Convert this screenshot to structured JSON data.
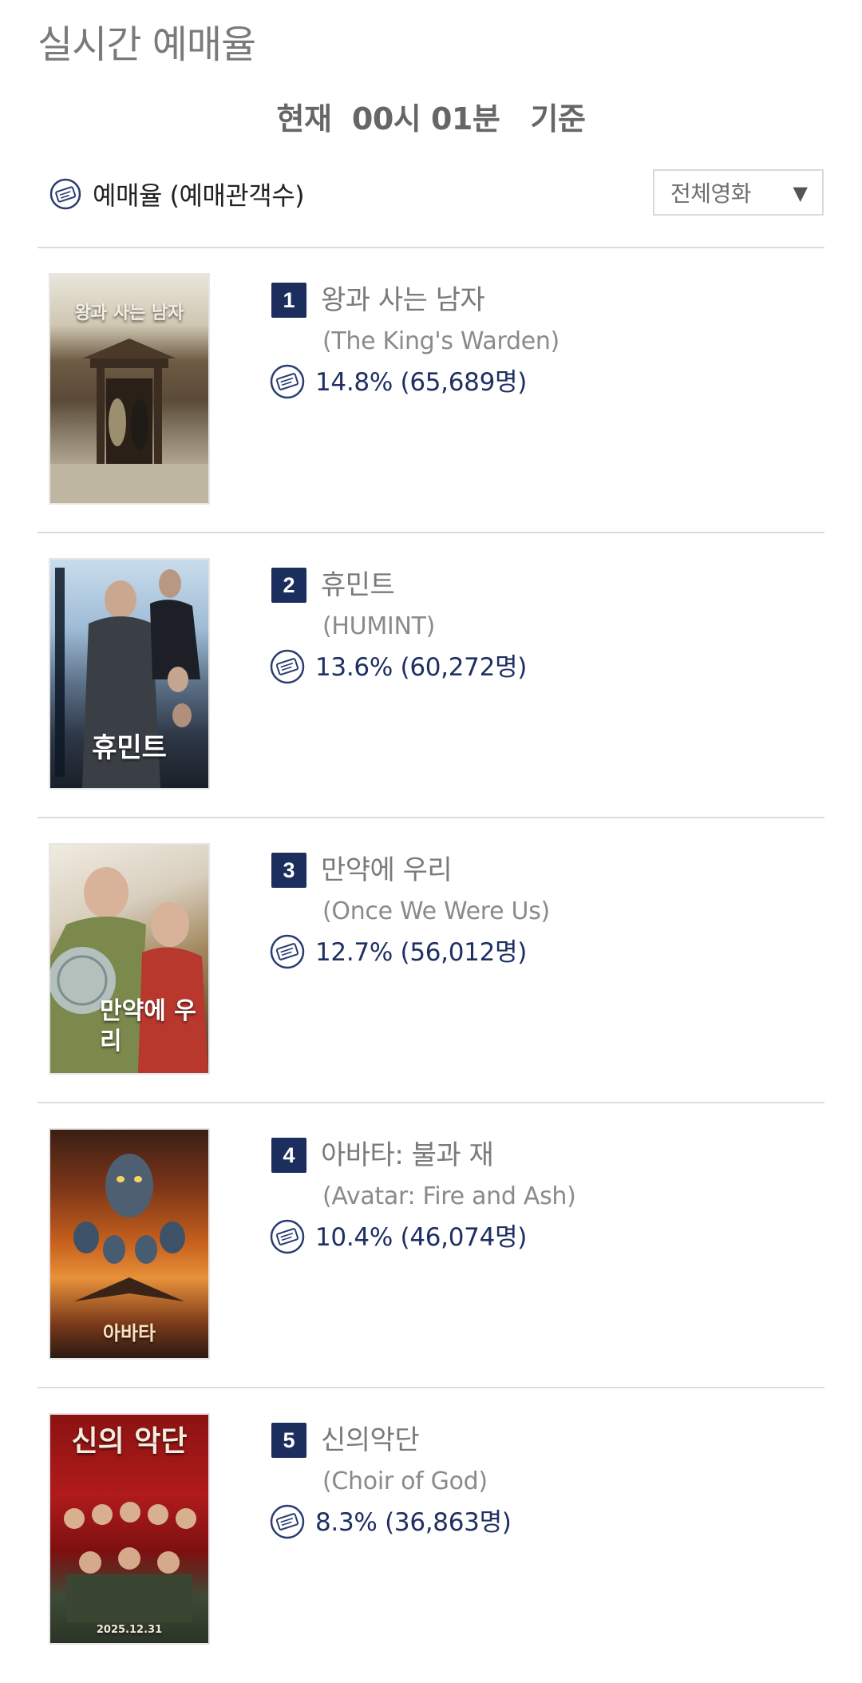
{
  "page": {
    "heading": "실시간 예매율",
    "time_line": "현재  00시 01분   기준"
  },
  "legend": {
    "icon": "ticket-icon",
    "label": "예매율 (예매관객수)"
  },
  "filter": {
    "selected": "전체영화",
    "arrow": "▼"
  },
  "colors": {
    "badge_bg": "#1b2e5e",
    "rate_text": "#1e2f63",
    "title_text": "#7a7a7a",
    "divider": "#dcdcdc"
  },
  "movies": [
    {
      "rank": "1",
      "title_ko": "왕과 사는 남자",
      "title_en": "(The King's Warden)",
      "rate": "14.8% (65,689명)",
      "poster_text": "왕과 사는 남자"
    },
    {
      "rank": "2",
      "title_ko": "휴민트",
      "title_en": "(HUMINT)",
      "rate": "13.6% (60,272명)",
      "poster_text": "휴민트"
    },
    {
      "rank": "3",
      "title_ko": "만약에 우리",
      "title_en": "(Once We Were Us)",
      "rate": "12.7% (56,012명)",
      "poster_text": "만약에 우리"
    },
    {
      "rank": "4",
      "title_ko": "아바타: 불과 재",
      "title_en": "(Avatar: Fire and Ash)",
      "rate": "10.4% (46,074명)",
      "poster_text": "아바타"
    },
    {
      "rank": "5",
      "title_ko": "신의악단",
      "title_en": "(Choir of God)",
      "rate": "8.3% (36,863명)",
      "poster_text": "신의 악단",
      "poster_date": "2025.12.31"
    }
  ]
}
